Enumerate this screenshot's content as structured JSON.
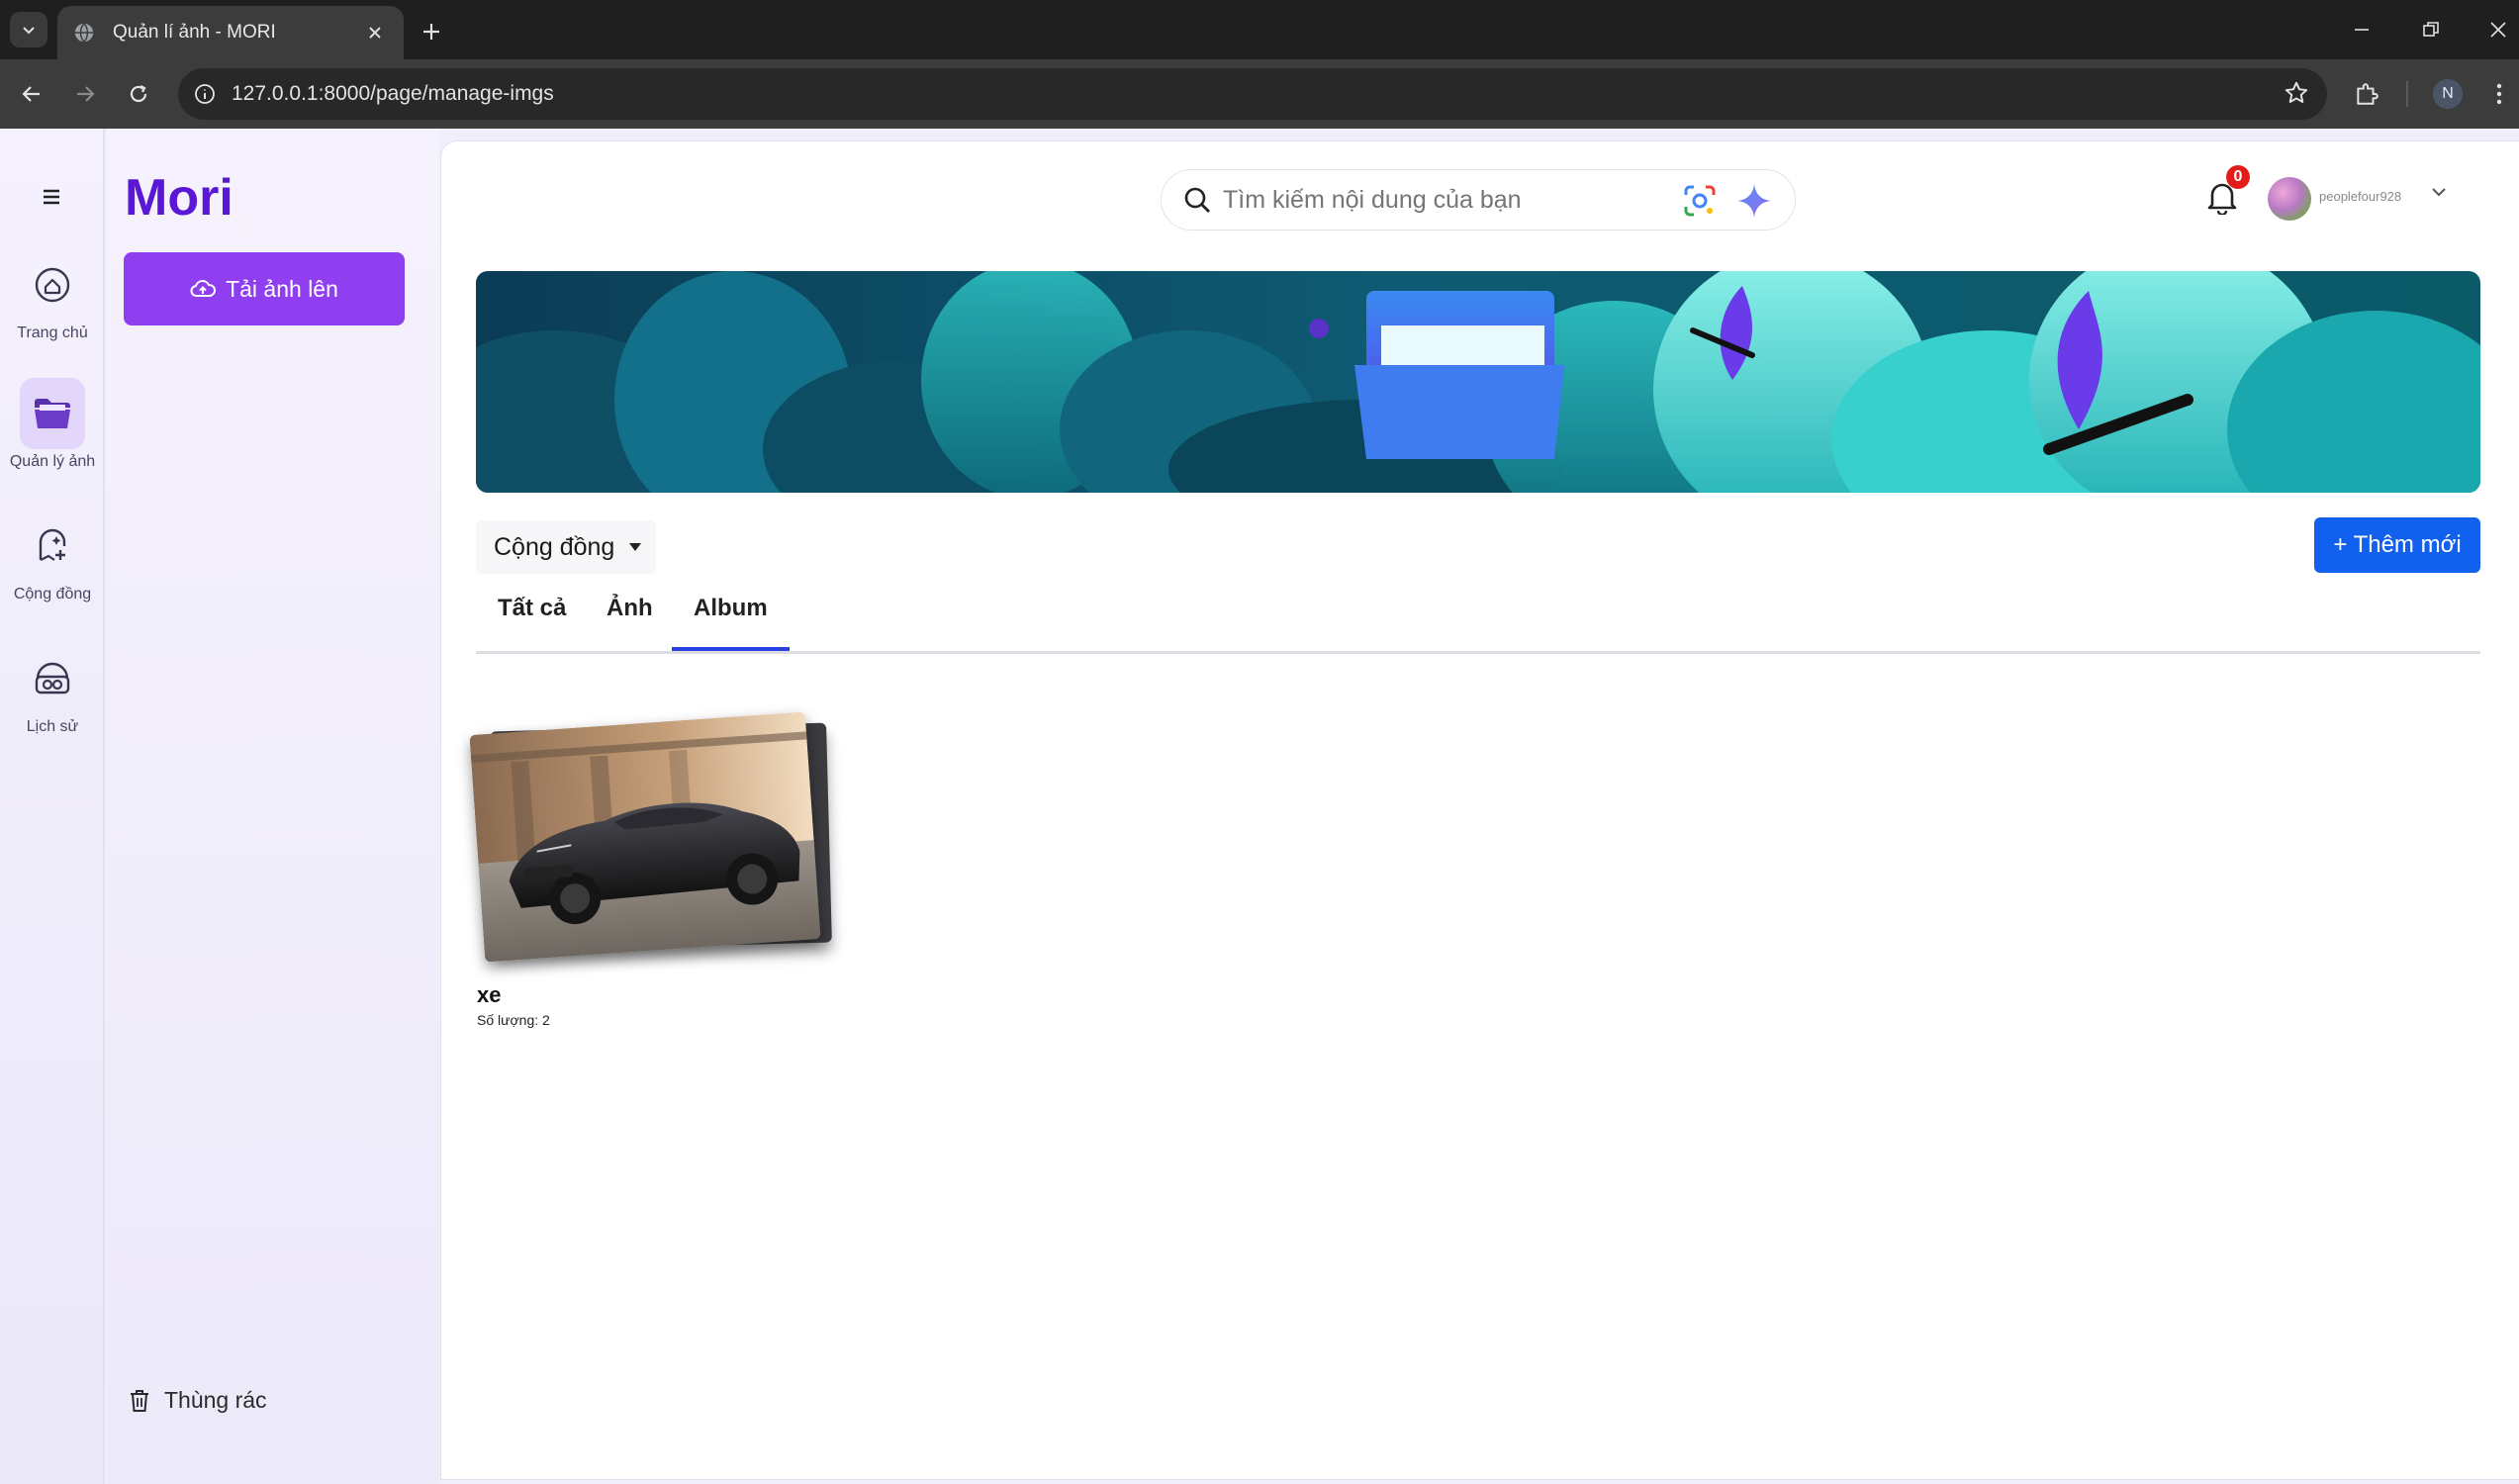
{
  "browser": {
    "tab_title": "Quản lí ảnh - MORI",
    "url": "127.0.0.1:8000/page/manage-imgs",
    "profile_initial": "N"
  },
  "sidebar": {
    "items": [
      {
        "label": "Trang chủ",
        "icon": "home-icon"
      },
      {
        "label": "Quản lý ảnh",
        "icon": "folder-icon",
        "active": true
      },
      {
        "label": "Cộng đồng",
        "icon": "community-icon"
      },
      {
        "label": "Lịch sử",
        "icon": "history-icon"
      }
    ]
  },
  "panel": {
    "brand": "Mori",
    "upload_label": "Tải ảnh lên",
    "trash_label": "Thùng rác"
  },
  "header": {
    "search_placeholder": "Tìm kiếm nội dung của bạn",
    "notification_count": "0",
    "username": "peoplefour928"
  },
  "toolbar": {
    "filter_label": "Cộng đồng",
    "add_label": "+ Thêm mới"
  },
  "tabs": [
    {
      "label": "Tất cả"
    },
    {
      "label": "Ảnh"
    },
    {
      "label": "Album",
      "active": true
    }
  ],
  "albums": [
    {
      "name": "xe",
      "count_text": "Số lượng: 2"
    }
  ],
  "colors": {
    "brand": "#5a18d6",
    "upload_button": "#8f3ff0",
    "add_button": "#1260ee",
    "active_tab_underline": "#2a3fe0",
    "badge": "#e41b1b"
  }
}
